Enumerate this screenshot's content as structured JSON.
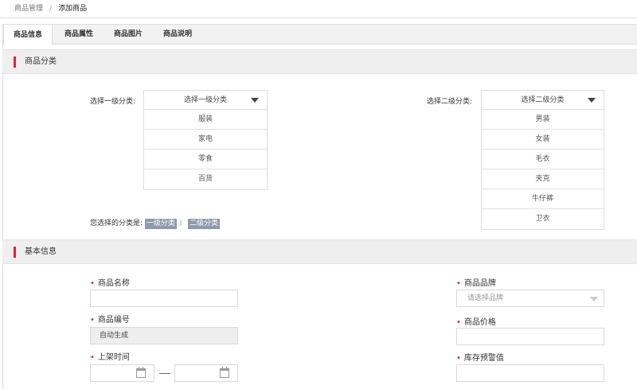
{
  "breadcrumb": {
    "parent": "商品管理",
    "separator": "/",
    "current": "添加商品"
  },
  "tabs": [
    {
      "label": "商品信息",
      "active": true
    },
    {
      "label": "商品属性",
      "active": false
    },
    {
      "label": "商品图片",
      "active": false
    },
    {
      "label": "商品说明",
      "active": false
    }
  ],
  "category_section": {
    "title": "商品分类",
    "level1": {
      "label": "选择一级分类:",
      "selected": "选择一级分类",
      "options": [
        "服装",
        "家电",
        "零食",
        "百货"
      ]
    },
    "level2": {
      "label": "选择二级分类:",
      "selected": "选择二级分类",
      "options": [
        "男装",
        "女装",
        "毛衣",
        "夹克",
        "牛仔裤",
        "卫衣"
      ]
    },
    "chosen": {
      "label": "您选择的分类是:",
      "level1_tag": "一级分类",
      "arrow": "》",
      "level2_tag": "二级分类"
    }
  },
  "basic_section": {
    "title": "基本信息",
    "required_mark": "•",
    "product_name": {
      "label": "商品名称",
      "value": ""
    },
    "product_code": {
      "label": "商品编号",
      "value": "自动生成"
    },
    "listing_time": {
      "label": "上架时间"
    },
    "brand": {
      "label": "商品品牌",
      "placeholder": "请选择品牌"
    },
    "price": {
      "label": "商品价格",
      "value": ""
    },
    "stock_alert": {
      "label": "库存预警值",
      "value": ""
    }
  },
  "colors": {
    "accent": "#e3223a",
    "tag_bg": "#8e9bab"
  }
}
